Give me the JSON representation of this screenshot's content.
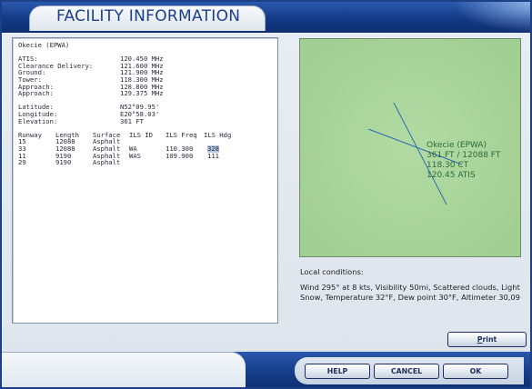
{
  "window": {
    "title": "FACILITY INFORMATION"
  },
  "info": {
    "airport": "Okecie (EPWA)",
    "frequencies": [
      {
        "label": "ATIS:",
        "value": "120.450 MHz"
      },
      {
        "label": "Clearance Delivery:",
        "value": "121.600 MHz"
      },
      {
        "label": "Ground:",
        "value": "121.900 MHz"
      },
      {
        "label": "Tower:",
        "value": "118.300 MHz"
      },
      {
        "label": "Approach:",
        "value": "128.800 MHz"
      },
      {
        "label": "Approach:",
        "value": "129.375 MHz"
      }
    ],
    "position": [
      {
        "label": "Latitude:",
        "value": "N52°09.95'"
      },
      {
        "label": "Longitude:",
        "value": "E20°58.03'"
      },
      {
        "label": "Elevation:",
        "value": "361 FT"
      }
    ],
    "runway_headers": [
      "Runway",
      "Length",
      "Surface",
      "ILS ID",
      "ILS Freq",
      "ILS Hdg"
    ],
    "runways": [
      {
        "runway": "15",
        "length": "12088",
        "surface": "Asphalt",
        "ils_id": "",
        "ils_freq": "",
        "ils_hdg": ""
      },
      {
        "runway": "33",
        "length": "12088",
        "surface": "Asphalt",
        "ils_id": "WA",
        "ils_freq": "110.300",
        "ils_hdg": "328"
      },
      {
        "runway": "11",
        "length": "9190",
        "surface": "Asphalt",
        "ils_id": "WAS",
        "ils_freq": "109.900",
        "ils_hdg": "111"
      },
      {
        "runway": "29",
        "length": "9190",
        "surface": "Asphalt",
        "ils_id": "",
        "ils_freq": "",
        "ils_hdg": ""
      }
    ]
  },
  "map": {
    "labels": [
      "Okecie (EPWA)",
      "361  FT  /  12088  FT",
      "118.30  CT",
      "120.45  ATIS"
    ],
    "background_color": "#a9d49a",
    "runway_color": "#2e6bb0",
    "label_color": "#2d6a3f"
  },
  "conditions": {
    "title": "Local conditions:",
    "text": "Wind 295° at 8 kts, Visibility 50mi, Scattered clouds, Light Snow, Temperature 32°F, Dew point 30°F, Altimeter 30,09"
  },
  "buttons": {
    "print": {
      "prefix": "P",
      "rest": "rint"
    },
    "help": "HELP",
    "cancel": "CANCEL",
    "ok": "OK"
  }
}
